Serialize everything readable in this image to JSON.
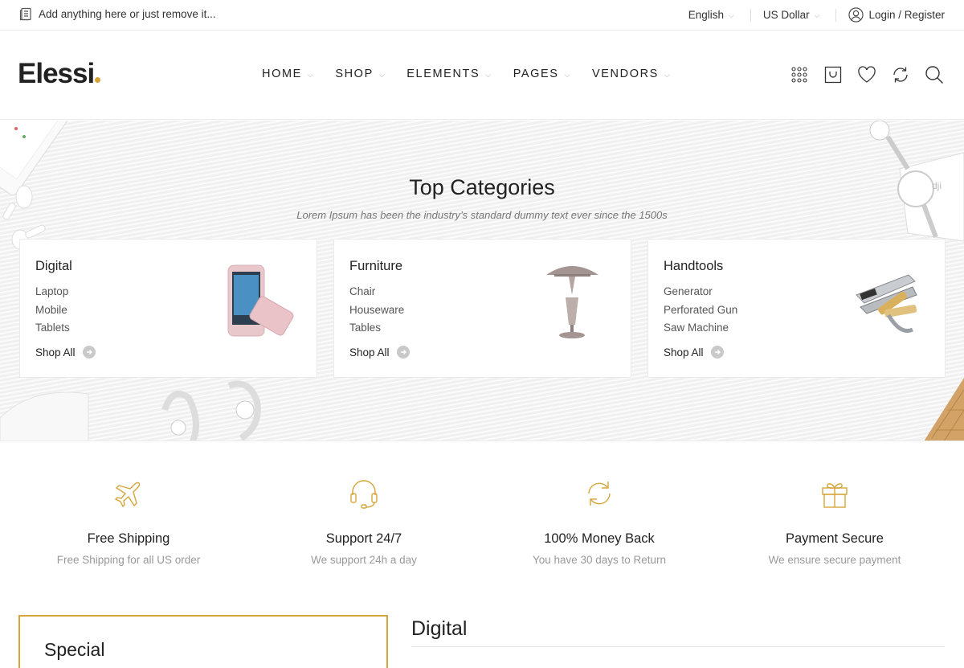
{
  "topbar": {
    "message": "Add anything here or just remove it...",
    "language": "English",
    "currency": "US Dollar",
    "account": "Login / Register"
  },
  "header": {
    "logo": "Elessi",
    "brand_color": "#d5a53a",
    "nav": [
      {
        "label": "HOME"
      },
      {
        "label": "SHOP"
      },
      {
        "label": "ELEMENTS"
      },
      {
        "label": "PAGES"
      },
      {
        "label": "VENDORS"
      }
    ],
    "icons": [
      "grid-icon",
      "cart-icon",
      "heart-icon",
      "compare-icon",
      "search-icon"
    ]
  },
  "hero": {
    "title": "Top Categories",
    "subtitle": "Lorem Ipsum has been the industry’s standard dummy text ever since the 1500s",
    "categories": [
      {
        "title": "Digital",
        "items": [
          "Laptop",
          "Mobile",
          "Tablets"
        ],
        "link": "Shop All",
        "image": "phone-image"
      },
      {
        "title": "Furniture",
        "items": [
          "Chair",
          "Houseware",
          "Tables"
        ],
        "link": "Shop All",
        "image": "lamp-image"
      },
      {
        "title": "Handtools",
        "items": [
          "Generator",
          "Perforated Gun",
          "Saw Machine"
        ],
        "link": "Shop All",
        "image": "tools-image"
      }
    ]
  },
  "features": [
    {
      "title": "Free Shipping",
      "desc": "Free Shipping for all US order",
      "icon": "plane-icon"
    },
    {
      "title": "Support 24/7",
      "desc": "We support 24h a day",
      "icon": "headset-icon"
    },
    {
      "title": "100% Money Back",
      "desc": "You have 30 days to Return",
      "icon": "refresh-icon"
    },
    {
      "title": "Payment Secure",
      "desc": "We ensure secure payment",
      "icon": "gift-icon"
    }
  ],
  "sections": {
    "special": "Special",
    "digital": "Digital"
  }
}
